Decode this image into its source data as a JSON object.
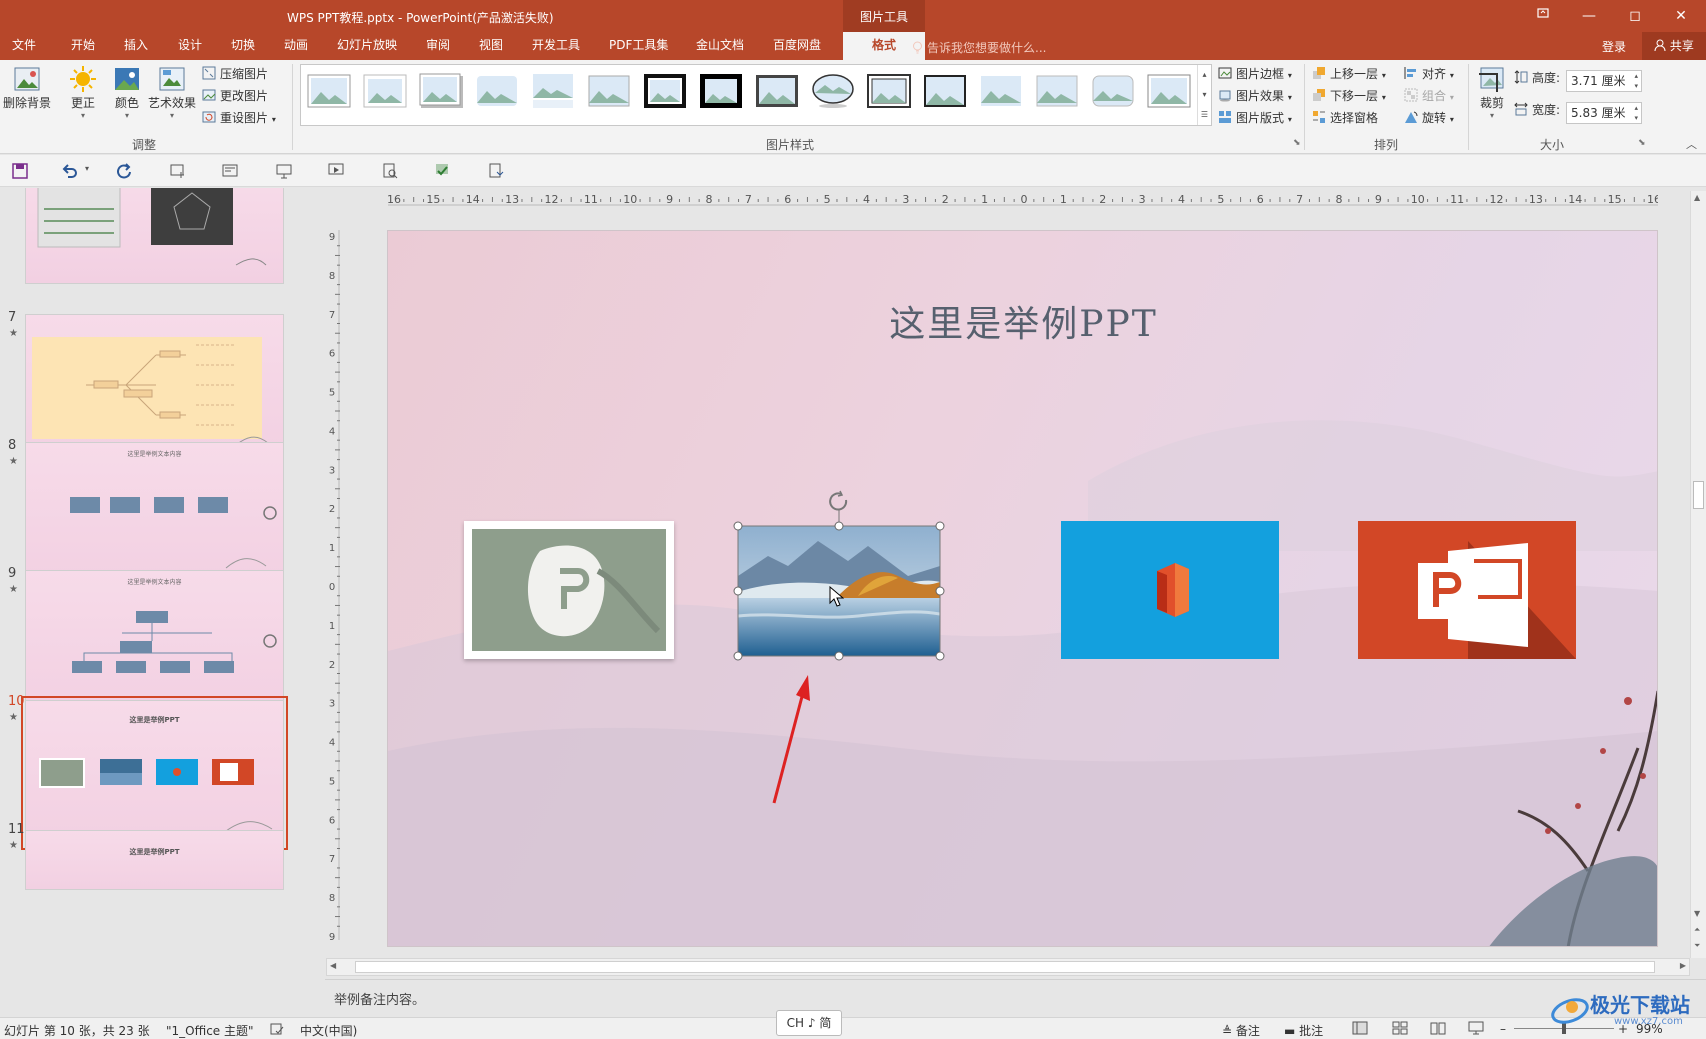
{
  "window": {
    "title": "WPS PPT教程.pptx - PowerPoint(产品激活失败)",
    "contextual_tab": "图片工具"
  },
  "tabs": [
    "文件",
    "开始",
    "插入",
    "设计",
    "切换",
    "动画",
    "幻灯片放映",
    "审阅",
    "视图",
    "开发工具",
    "PDF工具集",
    "金山文档",
    "百度网盘",
    "格式"
  ],
  "active_tab": "格式",
  "tell_me": "告诉我您想要做什么...",
  "account": {
    "login": "登录",
    "share": "共享"
  },
  "ribbon": {
    "adjust": {
      "remove_bg": "删除背景",
      "corrections": "更正",
      "color": "颜色",
      "artistic": "艺术效果",
      "compress": "压缩图片",
      "change": "更改图片",
      "reset": "重设图片",
      "label": "调整"
    },
    "styles": {
      "border": "图片边框",
      "effects": "图片效果",
      "layout": "图片版式",
      "label": "图片样式"
    },
    "arrange": {
      "bring_forward": "上移一层",
      "send_backward": "下移一层",
      "selection_pane": "选择窗格",
      "align": "对齐",
      "group": "组合",
      "rotate": "旋转",
      "label": "排列"
    },
    "size": {
      "crop": "裁剪",
      "height_label": "高度:",
      "height_value": "3.71 厘米",
      "width_label": "宽度:",
      "width_value": "5.83 厘米",
      "label": "大小"
    }
  },
  "thumbnails": [
    {
      "num": "7",
      "star": "★"
    },
    {
      "num": "8",
      "star": "★",
      "title": "这里是举例文本内容"
    },
    {
      "num": "9",
      "star": "★",
      "title": "这里是举例文本内容"
    },
    {
      "num": "10",
      "star": "★",
      "title": "这里是举例PPT"
    },
    {
      "num": "11",
      "star": "★",
      "title": "这里是举例PPT"
    }
  ],
  "slide": {
    "title": "这里是举例PPT"
  },
  "ruler_h": [
    "16",
    "15",
    "14",
    "13",
    "12",
    "11",
    "10",
    "9",
    "8",
    "7",
    "6",
    "5",
    "4",
    "3",
    "2",
    "1",
    "0",
    "1",
    "2",
    "3",
    "4",
    "5",
    "6",
    "7",
    "8",
    "9",
    "10",
    "11",
    "12",
    "13",
    "14",
    "15",
    "16"
  ],
  "ruler_v": [
    "9",
    "8",
    "7",
    "6",
    "5",
    "4",
    "3",
    "2",
    "1",
    "0",
    "1",
    "2",
    "3",
    "4",
    "5",
    "6",
    "7",
    "8",
    "9"
  ],
  "notes": "举例备注内容。",
  "status": {
    "slide_info": "幻灯片 第 10 张，共 23 张",
    "theme": "\"1_Office 主题\"",
    "language": "中文(中国)",
    "notes_btn": "备注",
    "comments_btn": "批注",
    "zoom": "99%"
  },
  "ime": "CH ♪ 简",
  "watermark": {
    "name": "极光下载站",
    "url": "www.xz7.com"
  },
  "colors": {
    "accent": "#b7472a",
    "office_blue": "#13a0de",
    "ppt_red": "#d24726"
  }
}
